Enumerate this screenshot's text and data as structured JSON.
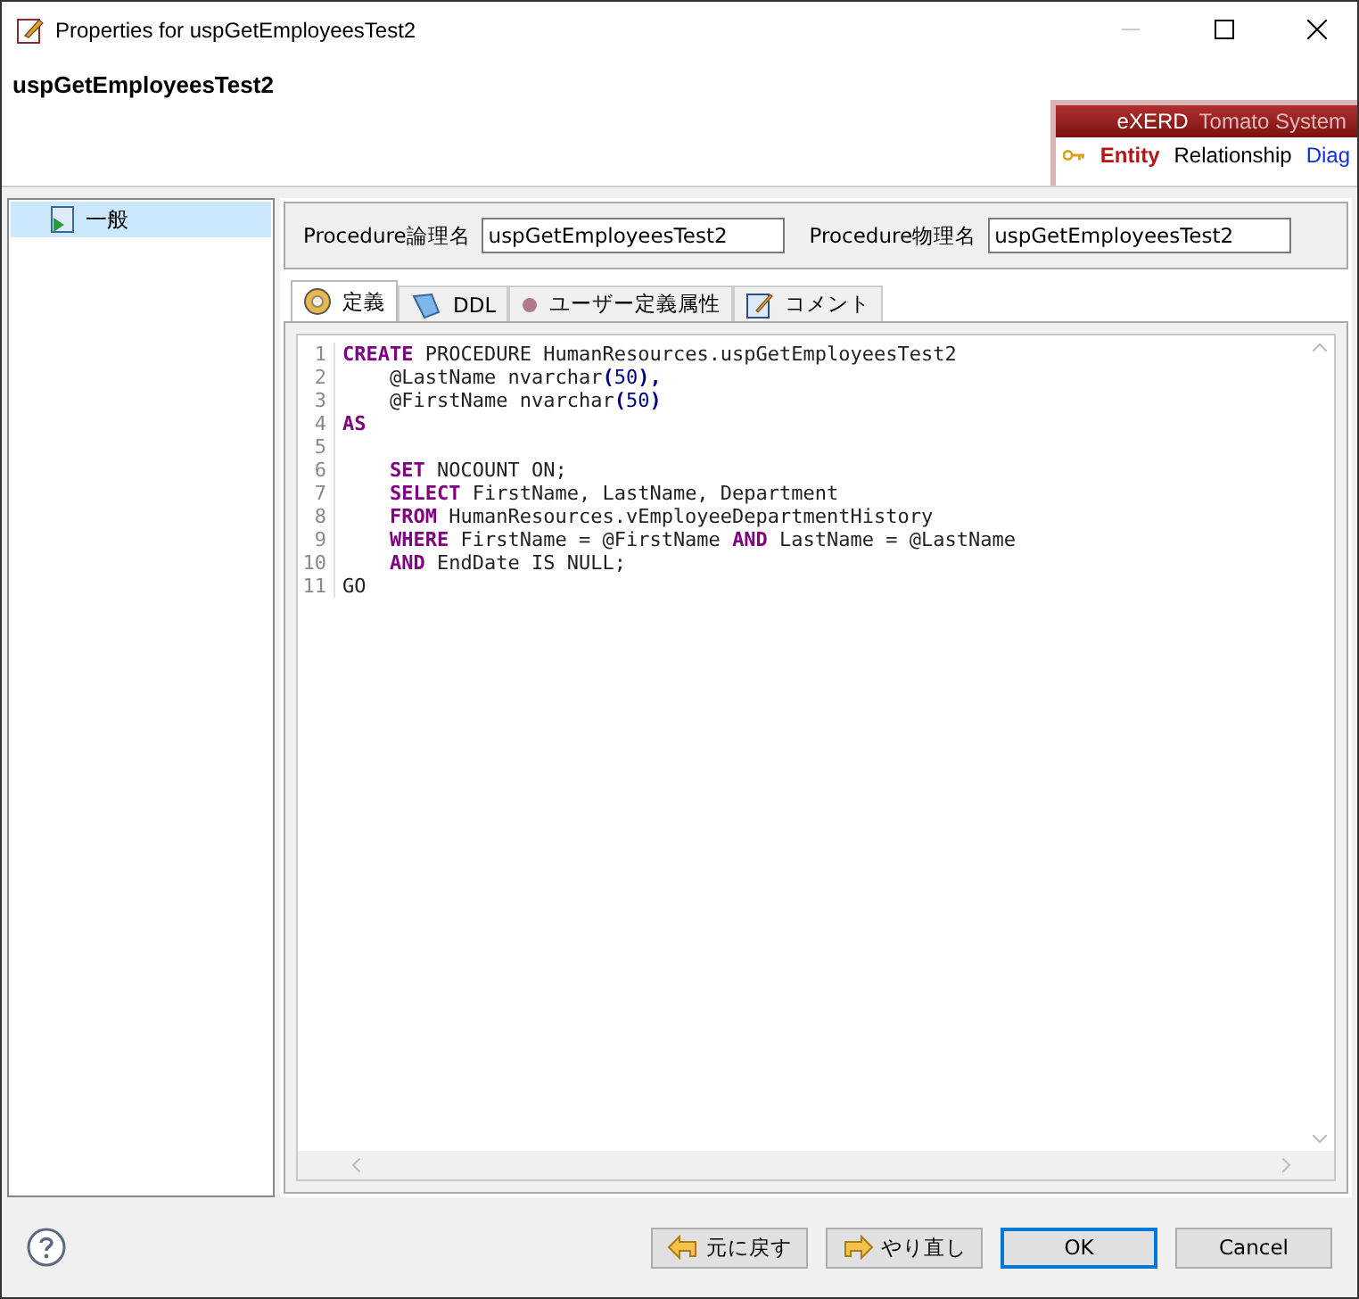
{
  "window": {
    "title": "Properties for uspGetEmployeesTest2"
  },
  "header": {
    "title": "uspGetEmployeesTest2",
    "banner": {
      "product": "eXERD",
      "company": "Tomato System",
      "items": [
        {
          "label": "Entity",
          "selected": true
        },
        {
          "label": "Relationship",
          "selected": false
        },
        {
          "label": "Diag",
          "selected": false
        }
      ]
    }
  },
  "tree": [
    {
      "label": "一般",
      "selected": true
    }
  ],
  "fields": [
    {
      "label": "Procedure論理名",
      "value": "uspGetEmployeesTest2"
    },
    {
      "label": "Procedure物理名",
      "value": "uspGetEmployeesTest2"
    }
  ],
  "tabs": [
    {
      "label": "定義",
      "selected": true
    },
    {
      "label": "DDL",
      "selected": false
    },
    {
      "label": "ユーザー定義属性",
      "selected": false
    },
    {
      "label": "コメント",
      "selected": false
    }
  ],
  "code": [
    {
      "number": "1",
      "indented": false,
      "tokens": [
        {
          "kind": "keyword",
          "text": "CREATE"
        },
        {
          "kind": "plain",
          "text": " PROCEDURE HumanResources.uspGetEmployeesTest2"
        }
      ]
    },
    {
      "number": "2",
      "indented": true,
      "tokens": [
        {
          "kind": "plain",
          "text": "@LastName nvarchar"
        },
        {
          "kind": "punct",
          "text": "("
        },
        {
          "kind": "number",
          "text": "50"
        },
        {
          "kind": "punct",
          "text": "),"
        }
      ]
    },
    {
      "number": "3",
      "indented": true,
      "tokens": [
        {
          "kind": "plain",
          "text": "@FirstName nvarchar"
        },
        {
          "kind": "punct",
          "text": "("
        },
        {
          "kind": "number",
          "text": "50"
        },
        {
          "kind": "punct",
          "text": ")"
        }
      ]
    },
    {
      "number": "4",
      "indented": false,
      "tokens": [
        {
          "kind": "keyword",
          "text": "AS"
        }
      ]
    },
    {
      "number": "5"
    },
    {
      "number": "6",
      "indented": true,
      "tokens": [
        {
          "kind": "keyword",
          "text": "SET"
        },
        {
          "kind": "plain",
          "text": " NOCOUNT ON;"
        }
      ]
    },
    {
      "number": "7",
      "indented": true,
      "tokens": [
        {
          "kind": "keyword",
          "text": "SELECT"
        },
        {
          "kind": "plain",
          "text": " FirstName, LastName, Department"
        }
      ]
    },
    {
      "number": "8",
      "indented": true,
      "tokens": [
        {
          "kind": "keyword",
          "text": "FROM"
        },
        {
          "kind": "plain",
          "text": " HumanResources.vEmployeeDepartmentHistory"
        }
      ]
    },
    {
      "number": "9",
      "indented": true,
      "tokens": [
        {
          "kind": "keyword",
          "text": "WHERE"
        },
        {
          "kind": "plain",
          "text": " FirstName = @FirstName "
        },
        {
          "kind": "keyword",
          "text": "AND"
        },
        {
          "kind": "plain",
          "text": " LastName = @LastName"
        }
      ]
    },
    {
      "number": "10",
      "indented": true,
      "tokens": [
        {
          "kind": "keyword",
          "text": "AND"
        },
        {
          "kind": "plain",
          "text": " EndDate IS NULL;"
        }
      ]
    },
    {
      "number": "11",
      "indented": false,
      "tokens": [
        {
          "kind": "plain",
          "text": "GO"
        }
      ]
    }
  ],
  "buttons": [
    {
      "label": "元に戻す",
      "default": false
    },
    {
      "label": "やり直し",
      "default": false
    },
    {
      "label": "OK",
      "default": true
    },
    {
      "label": "Cancel",
      "default": false
    }
  ]
}
